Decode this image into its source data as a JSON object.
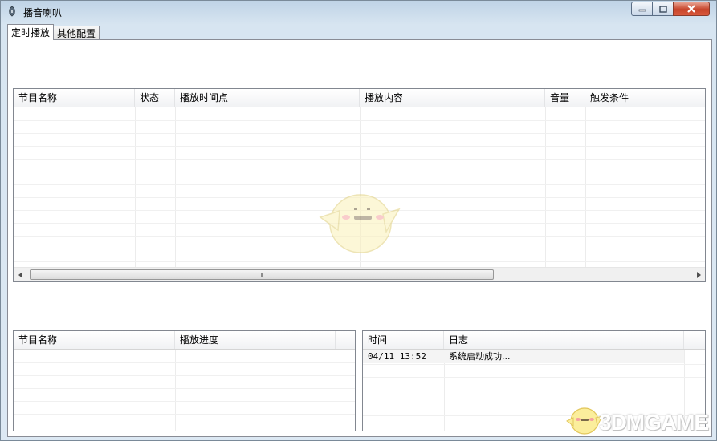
{
  "window": {
    "title": "播音喇叭"
  },
  "tabs": [
    {
      "label": "定时播放",
      "active": true
    },
    {
      "label": "其他配置",
      "active": false
    }
  ],
  "schedule_table": {
    "columns": [
      "节目名称",
      "状态",
      "播放时间点",
      "播放内容",
      "音量",
      "触发条件"
    ],
    "rows": []
  },
  "progress_table": {
    "columns": [
      "节目名称",
      "播放进度"
    ],
    "rows": []
  },
  "log_table": {
    "columns": [
      "时间",
      "日志"
    ],
    "rows": [
      {
        "time": "04/11 13:52",
        "message": "系统启动成功..."
      }
    ]
  },
  "scroll_grip": "III",
  "watermark": {
    "text": "3DMGAME"
  },
  "colors": {
    "accent": "#3a86c8",
    "close_button": "#c7442a",
    "grid_border": "#828790"
  }
}
